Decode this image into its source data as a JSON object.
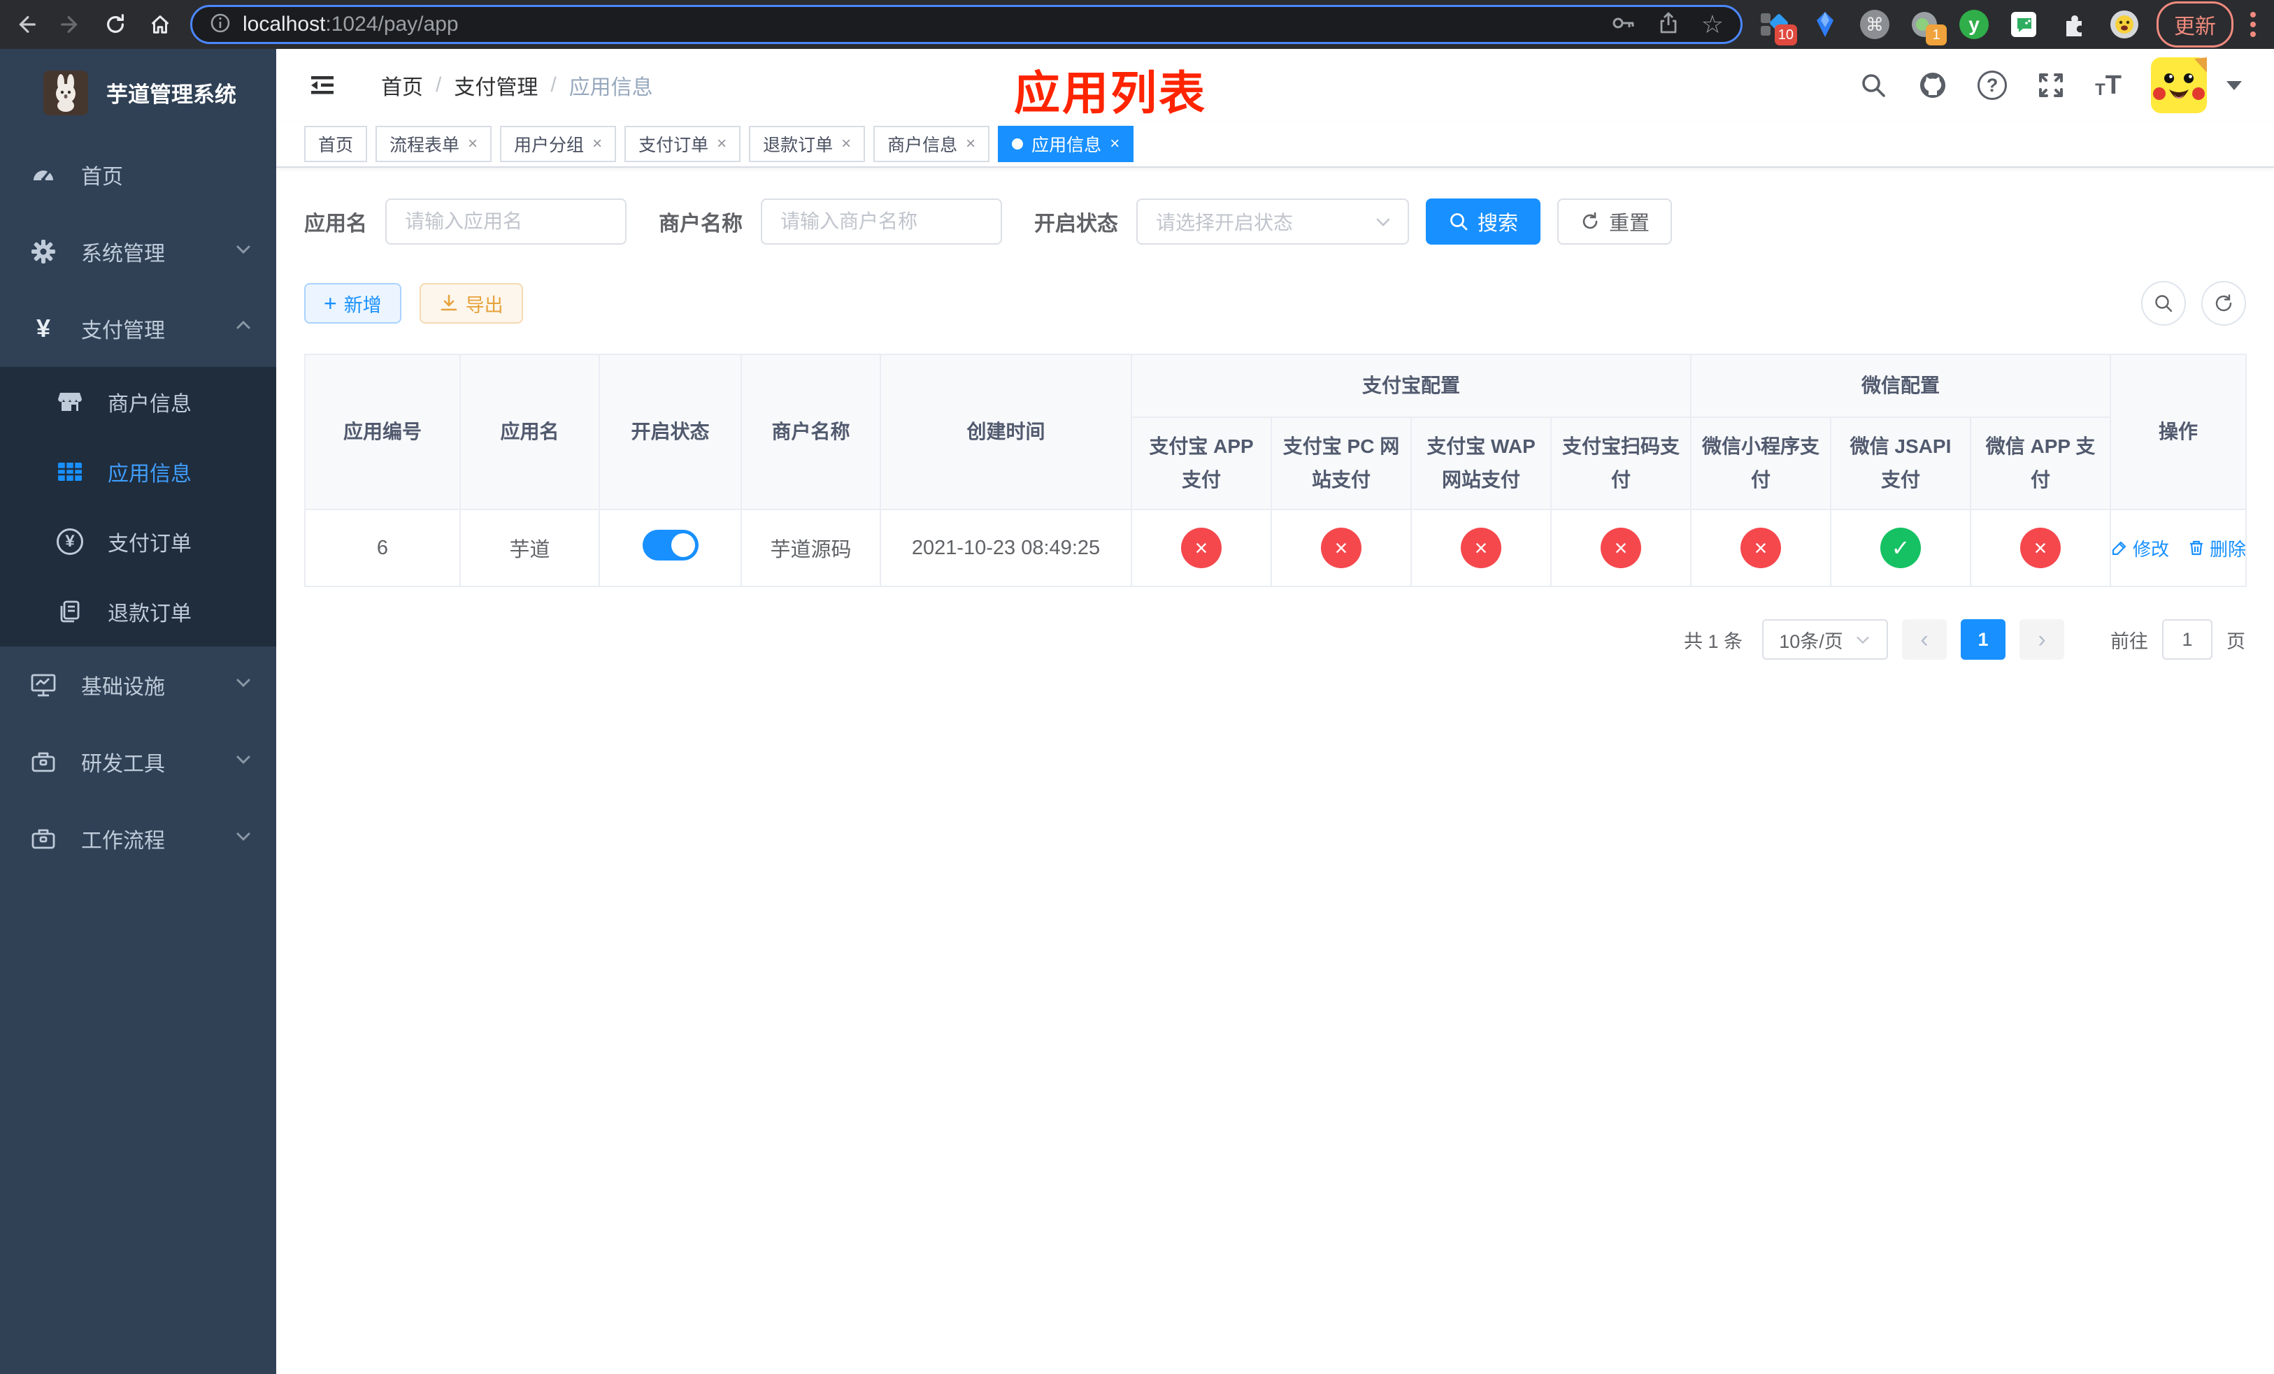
{
  "browser": {
    "url_host": "localhost",
    "url_path": ":1024/pay/app",
    "update_label": "更新",
    "ext_badge_meta": "10",
    "ext_badge_session": "1"
  },
  "sidebar": {
    "title": "芋道管理系统",
    "items": [
      {
        "label": "首页"
      },
      {
        "label": "系统管理"
      },
      {
        "label": "支付管理"
      },
      {
        "label": "商户信息"
      },
      {
        "label": "应用信息"
      },
      {
        "label": "支付订单"
      },
      {
        "label": "退款订单"
      },
      {
        "label": "基础设施"
      },
      {
        "label": "研发工具"
      },
      {
        "label": "工作流程"
      }
    ]
  },
  "header": {
    "breadcrumb": [
      "首页",
      "支付管理",
      "应用信息"
    ],
    "annotation": "应用列表"
  },
  "tabs": [
    {
      "label": "首页"
    },
    {
      "label": "流程表单"
    },
    {
      "label": "用户分组"
    },
    {
      "label": "支付订单"
    },
    {
      "label": "退款订单"
    },
    {
      "label": "商户信息"
    },
    {
      "label": "应用信息"
    }
  ],
  "filters": {
    "app_name_label": "应用名",
    "app_name_placeholder": "请输入应用名",
    "merchant_label": "商户名称",
    "merchant_placeholder": "请输入商户名称",
    "status_label": "开启状态",
    "status_placeholder": "请选择开启状态",
    "search_label": "搜索",
    "reset_label": "重置"
  },
  "toolbar": {
    "add_label": "新增",
    "export_label": "导出"
  },
  "table": {
    "columns": [
      "应用编号",
      "应用名",
      "开启状态",
      "商户名称",
      "创建时间"
    ],
    "group_alipay": "支付宝配置",
    "group_wechat": "微信配置",
    "sub_alipay": [
      "支付宝 APP 支付",
      "支付宝 PC 网站支付",
      "支付宝 WAP 网站支付",
      "支付宝扫码支付"
    ],
    "sub_wechat": [
      "微信小程序支付",
      "微信 JSAPI 支付",
      "微信 APP 支付"
    ],
    "actions_col": "操作",
    "rows": [
      {
        "id": "6",
        "name": "芋道",
        "enabled": true,
        "merchant": "芋道源码",
        "created": "2021-10-23 08:49:25",
        "channels": [
          "off",
          "off",
          "off",
          "off",
          "off",
          "on",
          "off"
        ],
        "edit_label": "修改",
        "delete_label": "删除"
      }
    ]
  },
  "pagination": {
    "total": "共 1 条",
    "page_size": "10条/页",
    "page": "1",
    "goto_label": "前往",
    "goto_value": "1",
    "page_unit": "页"
  },
  "glyphs": {
    "close": "×",
    "check": "✓",
    "cross": "×",
    "prev": "‹",
    "next": "›",
    "plus": "+",
    "sep": "/",
    "star": "☆",
    "cmd": "⌘",
    "yen": "¥",
    "question": "?",
    "t_small": "T",
    "t_big": "T"
  },
  "colors": {
    "primary": "#1890ff",
    "menu_active": "#409eff",
    "success": "#15c163",
    "danger": "#f5484d",
    "warning": "#e6a23c",
    "sidebar_bg": "#304156",
    "submenu_bg": "#1f2d3d",
    "annotation_red": "#ff2400"
  }
}
